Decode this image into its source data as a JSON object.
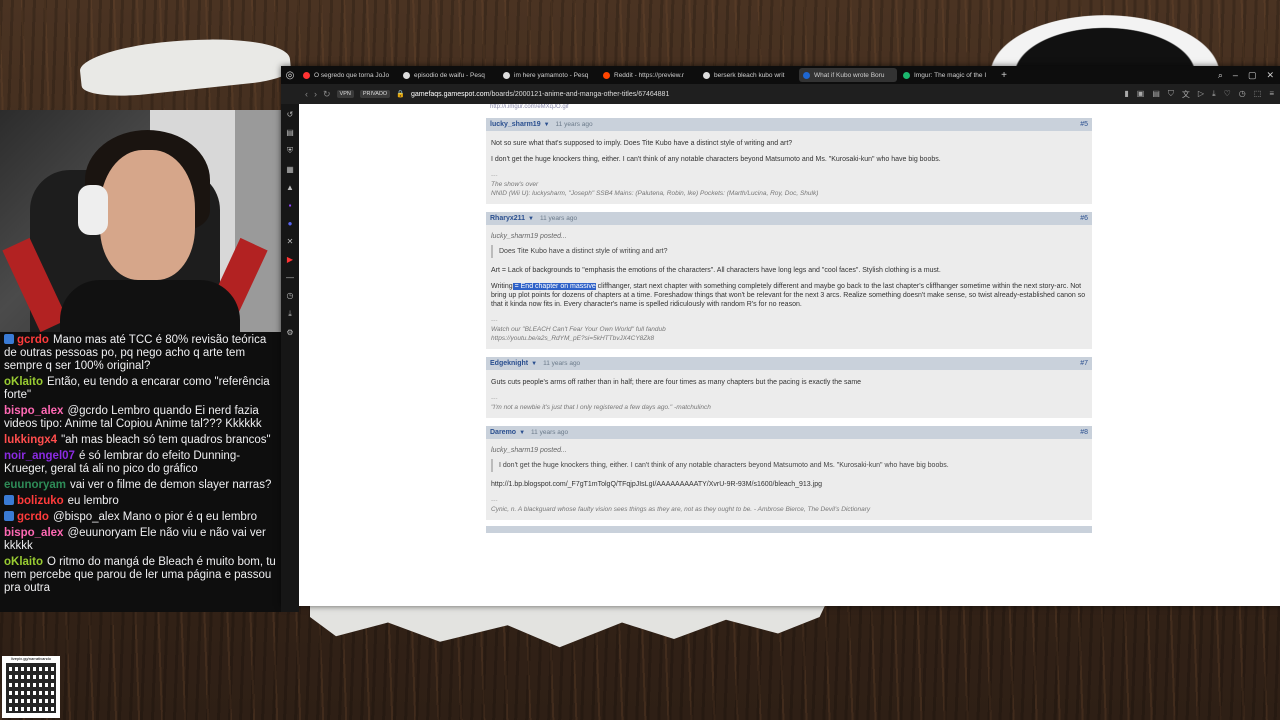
{
  "browser": {
    "tabs": [
      {
        "label": "O segredo que torna JoJo",
        "color": "#ff3333"
      },
      {
        "label": "episodio de waifu - Pesq",
        "color": "#dddddd"
      },
      {
        "label": "im here yamamoto - Pesq",
        "color": "#dddddd"
      },
      {
        "label": "Reddit - https://preview.r",
        "color": "#ff4500"
      },
      {
        "label": "berserk bleach kubo writ",
        "color": "#dddddd"
      },
      {
        "label": "What if Kubo wrote Boru",
        "color": "#1e66d0",
        "active": true
      },
      {
        "label": "Imgur: The magic of the I",
        "color": "#1bb76e"
      }
    ],
    "vpn_label": "VPN",
    "private_label": "PRIVADO",
    "url_domain": "gamefaqs.gamespot.com",
    "url_path": "/boards/2000121-anime-and-manga-other-titles/67464881"
  },
  "page": {
    "prev_link": "http://i.imgur.com/eMXqJO.gif",
    "posts": [
      {
        "author": "lucky_sharm19",
        "time": "11 years ago",
        "num": "#5",
        "paragraphs": [
          "Not so sure what that's supposed to imply. Does Tite Kubo have a distinct style of writing and art?",
          "I don't get the huge knockers thing, either. I can't think of any notable characters beyond Matsumoto and Ms. \"Kurosaki-kun\" who have big boobs."
        ],
        "sig_dash": "---",
        "sig_lines": [
          "The show's over",
          "NNID (Wii U): luckysharm, \"Joseph\" SSB4 Mains: (Palutena, Robin, Ike) Pockets: (Marth/Lucina, Roy, Doc, Shulk)"
        ]
      },
      {
        "author": "Rharyx211",
        "time": "11 years ago",
        "num": "#6",
        "quote_by": "lucky_sharm19 posted...",
        "quote": "Does Tite Kubo have a distinct style of writing and art?",
        "art": "Art = Lack of backgrounds to \"emphasis the emotions of the characters\". All characters have long legs and \"cool faces\". Stylish clothing is a must.",
        "writing_prefix": "Writing",
        "writing_highlight": " = End chapter on massive",
        "writing_rest": " cliffhanger, start next chapter with something completely different and maybe go back to the last chapter's cliffhanger sometime within the next story-arc. Not bring up plot points for dozens of chapters at a time. Foreshadow things that won't be relevant for the next 3 arcs. Realize something doesn't make sense, so twist already-established canon so that it kinda now fits in. Every character's name is spelled ridiculously with random R's for no reason.",
        "sig_dash": "---",
        "sig_lines": [
          "Watch our \"BLEACH Can't Fear Your Own World\" full fandub",
          "https://youtu.be/a2s_RdYM_pE?si=5kHTTbvJX4CY8Zk8"
        ]
      },
      {
        "author": "Edgeknight",
        "time": "11 years ago",
        "num": "#7",
        "paragraphs": [
          "Guts cuts people's arms off rather than in half; there are four times as many chapters but the pacing is exactly the same"
        ],
        "sig_dash": "---",
        "sig_lines": [
          "\"I'm not a newbie it's just that I only registered a few days ago.\" -matchulinch"
        ]
      },
      {
        "author": "Daremo",
        "time": "11 years ago",
        "num": "#8",
        "quote_by": "lucky_sharm19 posted...",
        "quote": "I don't get the huge knockers thing, either. I can't think of any notable characters beyond Matsumoto and Ms. \"Kurosaki-kun\" who have big boobs.",
        "link": "http://1.bp.blogspot.com/_F7gT1mTolgQ/TFqjpJIsLgI/AAAAAAAAATY/XvrU-9R-93M/s1600/bleach_913.jpg",
        "sig_dash": "---",
        "sig_lines": [
          "Cynic, n. A blackguard whose faulty vision sees things as they are, not as they ought to be. - Ambrose Bierce, The Devil's Dictionary"
        ]
      }
    ]
  },
  "chat": [
    {
      "user": "gcrdo",
      "color": "#ff3b3b",
      "badge": true,
      "text": "Mano mas até TCC é 80% revisão teórica de outras pessoas po, pq nego acho q arte tem sempre q ser 100% original?"
    },
    {
      "user": "oKlaito",
      "color": "#9acd32",
      "badge": false,
      "text": "Então, eu tendo a encarar como \"referência forte\""
    },
    {
      "user": "bispo_alex",
      "color": "#ff69b4",
      "badge": false,
      "text": "@gcrdo Lembro quando Ei nerd fazia videos tipo: Anime tal Copiou Anime tal??? Kkkkkk"
    },
    {
      "user": "lukkingx4",
      "color": "#ff4d4d",
      "badge": false,
      "text": "\"ah mas bleach só tem quadros brancos\""
    },
    {
      "user": "noir_angel07",
      "color": "#8a2be2",
      "badge": false,
      "text": "é só lembrar do efeito Dunning-Krueger, geral tá ali no pico do gráfico"
    },
    {
      "user": "euunoryam",
      "color": "#2e8b57",
      "badge": false,
      "text": "vai ver o filme de demon slayer narras?"
    },
    {
      "user": "bolizuko",
      "color": "#ff3b3b",
      "badge": true,
      "text": "eu lembro"
    },
    {
      "user": "gcrdo",
      "color": "#ff3b3b",
      "badge": true,
      "text": "@bispo_alex Mano o pior é q eu lembro"
    },
    {
      "user": "bispo_alex",
      "color": "#ff69b4",
      "badge": false,
      "text": "@euunoryam Ele não viu e não vai ver kkkkk"
    },
    {
      "user": "oKlaito",
      "color": "#9acd32",
      "badge": false,
      "text": "O ritmo do mangá de Bleach é muito bom, tu nem percebe que parou de ler uma página e passou pra outra"
    }
  ],
  "qr": {
    "caption": "livepix.gg/narrativando"
  }
}
